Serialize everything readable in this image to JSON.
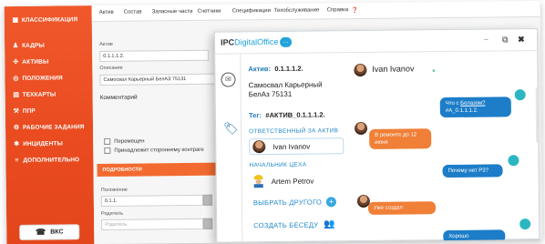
{
  "sidebar": {
    "items": [
      {
        "label": "КЛАССИФИКАЦИЯ",
        "icon": "grid-icon",
        "glyph": "▦"
      },
      {
        "label": "КАДРЫ",
        "icon": "people-icon",
        "glyph": "♟"
      },
      {
        "label": "АКТИВЫ",
        "icon": "arrows-icon",
        "glyph": "✣"
      },
      {
        "label": "ПОЛОЖЕНИЯ",
        "icon": "target-icon",
        "glyph": "◎"
      },
      {
        "label": "ТЕХКАРТЫ",
        "icon": "document-icon",
        "glyph": "▤"
      },
      {
        "label": "ППР",
        "icon": "wrench-icon",
        "glyph": "⚒"
      },
      {
        "label": "РАБОЧИЕ ЗАДАНИЯ",
        "icon": "gear-icon",
        "glyph": "⚙"
      },
      {
        "label": "ИНЦИДЕНТЫ",
        "icon": "alert-icon",
        "glyph": "✱"
      },
      {
        "label": "ДОПОЛНИТЕЛЬНО",
        "icon": "more-icon",
        "glyph": "≡"
      }
    ],
    "bottom_button": {
      "label": "ВКС",
      "glyph": "☎"
    }
  },
  "topmenu": [
    "Актив",
    "Состав",
    "Запасные части",
    "Счетчики",
    "Спецификации",
    "Техобслуживание",
    "Справка"
  ],
  "form": {
    "asset_label": "Актив",
    "asset_value": "0.1.1.1.2.",
    "desc_label": "Описание",
    "desc_value": "Самосвал Карьерный БелАЗ 75131",
    "comment_label": "Комментарий",
    "check_moved": "Перемещен",
    "check_third_party": "Принадлежит стороннему контраге",
    "section_bar": "ПОДРОБНОСТИ",
    "position_label": "Положение",
    "position_value": "0.1.1.",
    "parent_label": "Родитель",
    "parent_value": "Родитель"
  },
  "chat": {
    "logo_prefix": "IPC",
    "logo_suffix": "DigitalOffice",
    "asset_line_label": "Актив:",
    "asset_line_value": "0.1.1.1.2.",
    "asset_desc": "Самосвал Карьерный БелАз 75131",
    "tag_label": "Тег:",
    "tag_value": "#АКТИВ_0.1.1.1.2.",
    "responsible_title": "ОТВЕТСТВЕННЫЙ ЗА АКТИВ",
    "responsible_name": "Ivan Ivanov",
    "chief_title": "НАЧАЛЬНИК ЦЕХА",
    "chief_name": "Artem Petrov",
    "choose_other": "ВЫБРАТЬ ДРУГОГО",
    "create_chat": "СОЗДАТЬ БЕСЕДУ",
    "contact_name": "Ivan Ivanov",
    "messages": [
      {
        "side": "right",
        "text_a": "Что с ",
        "text_link": "Белазом?",
        "text_b": "#А_0.1.1.1.2."
      },
      {
        "side": "left",
        "text": "В ремонте до 12 июня"
      },
      {
        "side": "right",
        "text": "Почему нет РЗ?"
      },
      {
        "side": "left",
        "text": "Уже создал"
      },
      {
        "side": "right",
        "text": "Хорошо"
      }
    ]
  },
  "colors": {
    "sidebar": "#e94a1f",
    "accent_blue": "#1e88c9",
    "bubble_blue": "#1d7dc8",
    "bubble_orange": "#f07f37"
  }
}
